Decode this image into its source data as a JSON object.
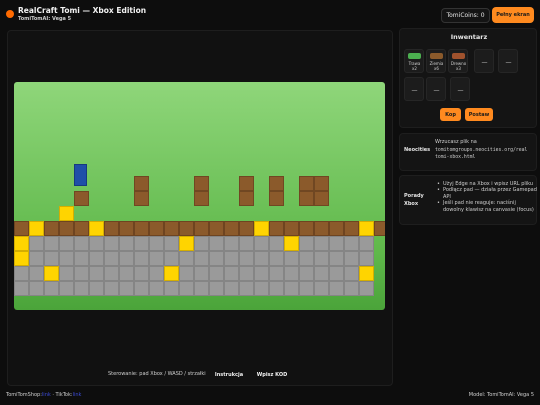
{
  "header": {
    "title": "RealCraft Tomi — Xbox Edition",
    "subtitle": "TomiTomAI: Vega 5",
    "coins_label": "TomiCoins: 0",
    "fullscreen_label": "Pełny ekran"
  },
  "game": {
    "controls_text": "Sterowanie: pad Xbox / WASD / strzałki",
    "help_label": "Instrukcja",
    "enter_code_label": "Wpisz KOD"
  },
  "inventory": {
    "title": "Inwentarz",
    "slots": [
      {
        "label": "Trawa",
        "count": "x2",
        "color": "#4caf50"
      },
      {
        "label": "Ziemia",
        "count": "x6",
        "color": "#8b5a2b"
      },
      {
        "label": "Drewno",
        "count": "x3",
        "color": "#a0522d"
      },
      {
        "label": "—"
      },
      {
        "label": "—"
      },
      {
        "label": "—"
      },
      {
        "label": "—"
      },
      {
        "label": "—"
      }
    ],
    "dig_label": "Kop",
    "place_label": "Postaw"
  },
  "neocities": {
    "label": "Neocities",
    "text": "Wrzucasz plik na",
    "url": "tomitomgroups.neocities.org/real",
    "file": "tomi-xbox.html"
  },
  "tips": {
    "label": "Porady Xbox",
    "items": [
      "Użyj Edge na Xbox i wpisz URL pliku",
      "Podłącz pad — działa przez Gamepad API",
      "Jeśli pad nie reaguje: naciśnij dowolny klawisz na canvasie (focus)"
    ]
  },
  "footer": {
    "left_prefix": "TomiTomShop:",
    "left_link1": "link",
    "left_sep": " · TikTok:",
    "left_link2": "link",
    "right": "Model: TomiTomAI: Vega 5"
  },
  "colors": {
    "accent": "#ff8a1f",
    "sky_top": "#8fd67a",
    "wood": "#8b5a2b",
    "gold": "#ffd400",
    "stone": "#9a9a9a",
    "player": "#1f4fa8"
  }
}
